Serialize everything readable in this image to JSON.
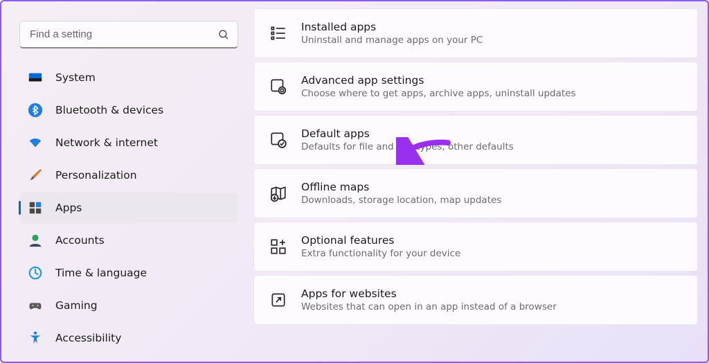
{
  "search": {
    "placeholder": "Find a setting"
  },
  "sidebar": {
    "items": [
      {
        "label": "System"
      },
      {
        "label": "Bluetooth & devices"
      },
      {
        "label": "Network & internet"
      },
      {
        "label": "Personalization"
      },
      {
        "label": "Apps"
      },
      {
        "label": "Accounts"
      },
      {
        "label": "Time & language"
      },
      {
        "label": "Gaming"
      },
      {
        "label": "Accessibility"
      }
    ]
  },
  "cards": [
    {
      "title": "Installed apps",
      "sub": "Uninstall and manage apps on your PC"
    },
    {
      "title": "Advanced app settings",
      "sub": "Choose where to get apps, archive apps, uninstall updates"
    },
    {
      "title": "Default apps",
      "sub": "Defaults for file and link types, other defaults"
    },
    {
      "title": "Offline maps",
      "sub": "Downloads, storage location, map updates"
    },
    {
      "title": "Optional features",
      "sub": "Extra functionality for your device"
    },
    {
      "title": "Apps for websites",
      "sub": "Websites that can open in an app instead of a browser"
    }
  ]
}
